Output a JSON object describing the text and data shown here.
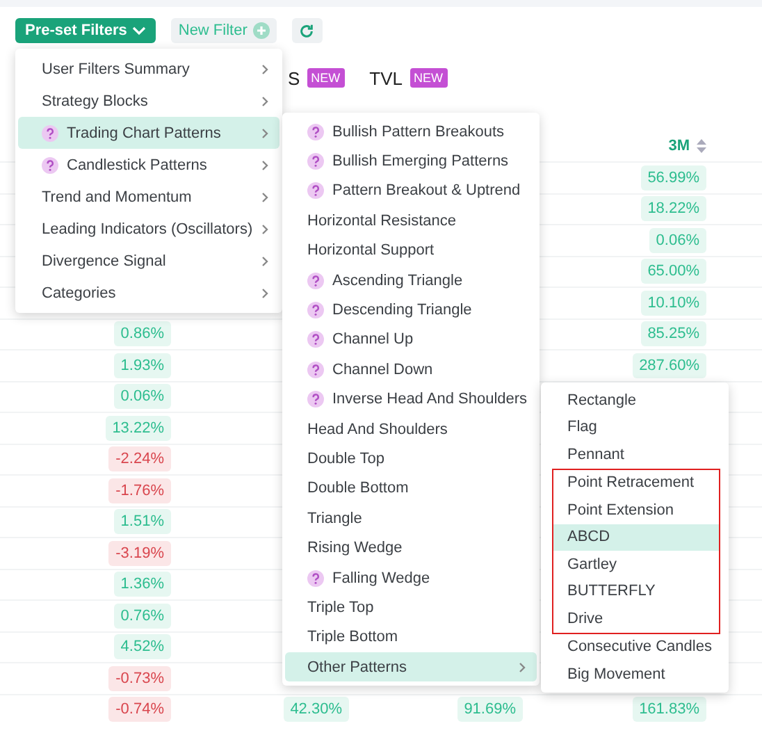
{
  "toolbar": {
    "preset_button": "Pre-set Filters",
    "new_filter_button": "New Filter"
  },
  "tabs": [
    {
      "label": "S",
      "badge": "NEW"
    },
    {
      "label": "TVL",
      "badge": "NEW"
    }
  ],
  "table": {
    "columns": [
      "",
      "",
      "",
      "3M"
    ],
    "rows": [
      {
        "cells": [
          null,
          null,
          null,
          {
            "value": "56.99%",
            "negative": false
          }
        ]
      },
      {
        "cells": [
          null,
          null,
          null,
          {
            "value": "18.22%",
            "negative": false
          }
        ]
      },
      {
        "cells": [
          null,
          null,
          null,
          {
            "value": "0.06%",
            "negative": false
          }
        ]
      },
      {
        "cells": [
          null,
          null,
          null,
          {
            "value": "65.00%",
            "negative": false
          }
        ]
      },
      {
        "cells": [
          null,
          null,
          null,
          {
            "value": "10.10%",
            "negative": false
          }
        ]
      },
      {
        "cells": [
          {
            "value": "0.86%",
            "negative": false
          },
          null,
          null,
          {
            "value": "85.25%",
            "negative": false
          }
        ]
      },
      {
        "cells": [
          {
            "value": "1.93%",
            "negative": false
          },
          null,
          null,
          {
            "value": "287.60%",
            "negative": false
          }
        ]
      },
      {
        "cells": [
          {
            "value": "0.06%",
            "negative": false
          },
          null,
          null,
          null
        ]
      },
      {
        "cells": [
          {
            "value": "13.22%",
            "negative": false
          },
          null,
          null,
          null
        ]
      },
      {
        "cells": [
          {
            "value": "-2.24%",
            "negative": true
          },
          null,
          null,
          null
        ]
      },
      {
        "cells": [
          {
            "value": "-1.76%",
            "negative": true
          },
          null,
          null,
          null
        ]
      },
      {
        "cells": [
          {
            "value": "1.51%",
            "negative": false
          },
          null,
          null,
          null
        ]
      },
      {
        "cells": [
          {
            "value": "-3.19%",
            "negative": true
          },
          null,
          null,
          null
        ]
      },
      {
        "cells": [
          {
            "value": "1.36%",
            "negative": false
          },
          null,
          null,
          null
        ]
      },
      {
        "cells": [
          {
            "value": "0.76%",
            "negative": false
          },
          null,
          null,
          null
        ]
      },
      {
        "cells": [
          {
            "value": "4.52%",
            "negative": false
          },
          null,
          null,
          null
        ]
      },
      {
        "cells": [
          {
            "value": "-0.73%",
            "negative": true
          },
          null,
          null,
          null
        ]
      },
      {
        "cells": [
          {
            "value": "-0.74%",
            "negative": true
          },
          {
            "value": "42.30%",
            "negative": false
          },
          {
            "value": "91.69%",
            "negative": false
          },
          {
            "value": "161.83%",
            "negative": false
          }
        ]
      }
    ]
  },
  "menu": {
    "items": [
      {
        "label": "User Filters Summary",
        "help": false,
        "submenu": true,
        "selected": false
      },
      {
        "label": "Strategy Blocks",
        "help": false,
        "submenu": true,
        "selected": false
      },
      {
        "label": "Trading Chart Patterns",
        "help": true,
        "submenu": true,
        "selected": true
      },
      {
        "label": "Candlestick Patterns",
        "help": true,
        "submenu": true,
        "selected": false
      },
      {
        "label": "Trend and Momentum",
        "help": false,
        "submenu": true,
        "selected": false
      },
      {
        "label": "Leading Indicators (Oscillators)",
        "help": false,
        "submenu": true,
        "selected": false
      },
      {
        "label": "Divergence Signal",
        "help": false,
        "submenu": true,
        "selected": false
      },
      {
        "label": "Categories",
        "help": false,
        "submenu": true,
        "selected": false
      }
    ]
  },
  "submenu": {
    "items": [
      {
        "label": "Bullish Pattern Breakouts",
        "help": true,
        "submenu": false,
        "selected": false
      },
      {
        "label": "Bullish Emerging Patterns",
        "help": true,
        "submenu": false,
        "selected": false
      },
      {
        "label": "Pattern Breakout & Uptrend",
        "help": true,
        "submenu": false,
        "selected": false
      },
      {
        "label": "Horizontal Resistance",
        "help": false,
        "submenu": false,
        "selected": false
      },
      {
        "label": "Horizontal Support",
        "help": false,
        "submenu": false,
        "selected": false
      },
      {
        "label": "Ascending Triangle",
        "help": true,
        "submenu": false,
        "selected": false
      },
      {
        "label": "Descending Triangle",
        "help": true,
        "submenu": false,
        "selected": false
      },
      {
        "label": "Channel Up",
        "help": true,
        "submenu": false,
        "selected": false
      },
      {
        "label": "Channel Down",
        "help": true,
        "submenu": false,
        "selected": false
      },
      {
        "label": "Inverse Head And Shoulders",
        "help": true,
        "submenu": false,
        "selected": false
      },
      {
        "label": "Head And Shoulders",
        "help": false,
        "submenu": false,
        "selected": false
      },
      {
        "label": "Double Top",
        "help": false,
        "submenu": false,
        "selected": false
      },
      {
        "label": "Double Bottom",
        "help": false,
        "submenu": false,
        "selected": false
      },
      {
        "label": "Triangle",
        "help": false,
        "submenu": false,
        "selected": false
      },
      {
        "label": "Rising Wedge",
        "help": false,
        "submenu": false,
        "selected": false
      },
      {
        "label": "Falling Wedge",
        "help": true,
        "submenu": false,
        "selected": false
      },
      {
        "label": "Triple Top",
        "help": false,
        "submenu": false,
        "selected": false
      },
      {
        "label": "Triple Bottom",
        "help": false,
        "submenu": false,
        "selected": false
      },
      {
        "label": "Other Patterns",
        "help": false,
        "submenu": true,
        "selected": true
      }
    ]
  },
  "other_patterns_menu": {
    "items": [
      {
        "label": "Rectangle",
        "selected": false,
        "outlined": false
      },
      {
        "label": "Flag",
        "selected": false,
        "outlined": false
      },
      {
        "label": "Pennant",
        "selected": false,
        "outlined": false
      },
      {
        "label": "Point Retracement",
        "selected": false,
        "outlined": true
      },
      {
        "label": "Point Extension",
        "selected": false,
        "outlined": true
      },
      {
        "label": "ABCD",
        "selected": true,
        "outlined": true
      },
      {
        "label": "Gartley",
        "selected": false,
        "outlined": true
      },
      {
        "label": "BUTTERFLY",
        "selected": false,
        "outlined": true
      },
      {
        "label": "Drive",
        "selected": false,
        "outlined": true
      },
      {
        "label": "Consecutive Candles",
        "selected": false,
        "outlined": false
      },
      {
        "label": "Big Movement",
        "selected": false,
        "outlined": false
      }
    ]
  }
}
